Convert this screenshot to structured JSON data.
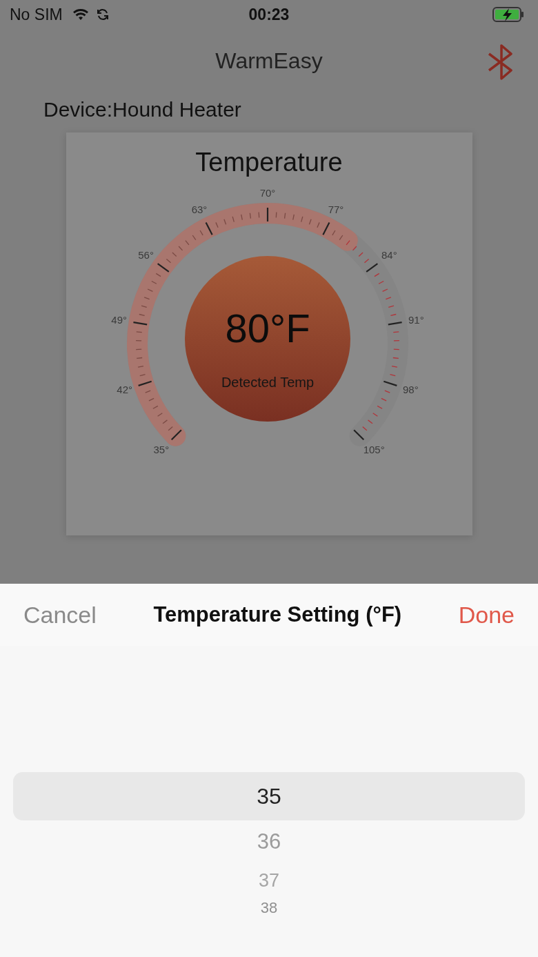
{
  "status_bar": {
    "carrier": "No SIM",
    "time": "00:23"
  },
  "nav": {
    "title": "WarmEasy"
  },
  "device_label": "Device:Hound Heater",
  "gauge": {
    "title": "Temperature",
    "reading": "80°F",
    "caption": "Detected Temp",
    "scale_labels": [
      "35°",
      "42°",
      "49°",
      "56°",
      "63°",
      "70°",
      "77°",
      "84°",
      "91°",
      "98°",
      "105°"
    ]
  },
  "sheet": {
    "cancel": "Cancel",
    "title": "Temperature Setting (°F)",
    "done": "Done",
    "picker": [
      {
        "label": "35",
        "selected": true
      },
      {
        "label": "36",
        "selected": false
      },
      {
        "label": "37",
        "selected": false
      },
      {
        "label": "38",
        "selected": false
      }
    ]
  }
}
